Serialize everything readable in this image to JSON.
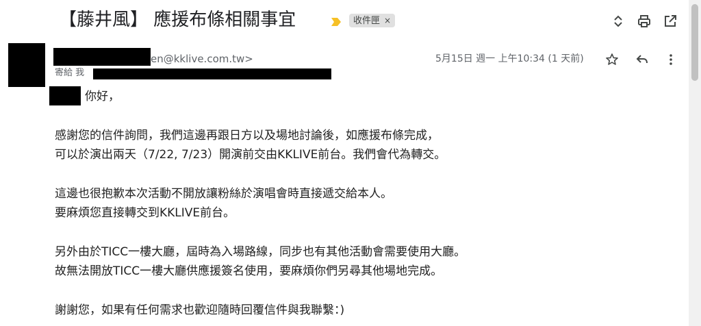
{
  "email": {
    "subject": "【藤井風】 應援布條相關事宜",
    "label": "收件匣",
    "label_remove": "×",
    "sender_email_suffix": "en@kklive.com.tw>",
    "to_prefix": "寄給 我",
    "date": "5月15日 週一 上午10:34 (1 天前)"
  },
  "body": {
    "greeting": "你好，",
    "lines": [
      "感謝您的信件詢問，我們這邊再跟日方以及場地討論後，如應援布條完成，",
      "可以於演出兩天（7/22, 7/23）開演前交由KKLIVE前台。我們會代為轉交。",
      "這邊也很抱歉本次活動不開放讓粉絲於演唱會時直接遞交給本人。",
      "要麻煩您直接轉交到KKLIVE前台。",
      "另外由於TICC一樓大廳，屆時為入場路線，同步也有其他活動會需要使用大廳。",
      "故無法開放TICC一樓大廳供應援簽名使用，要麻煩你們另尋其他場地完成。",
      "謝謝您，如果有任何需求也歡迎隨時回覆信件與我聯繫：)"
    ]
  },
  "icons": {
    "importance": "importance-marker-icon",
    "expand": "expand-collapse-icon",
    "print": "print-icon",
    "open_new_window": "open-in-new-window-icon",
    "star": "star-icon",
    "reply": "reply-icon",
    "more": "more-vert-icon"
  },
  "colors": {
    "importance": "#f6c026",
    "label_bg": "#e0e0e0",
    "text": "#202124",
    "secondary_text": "#5f6368"
  }
}
